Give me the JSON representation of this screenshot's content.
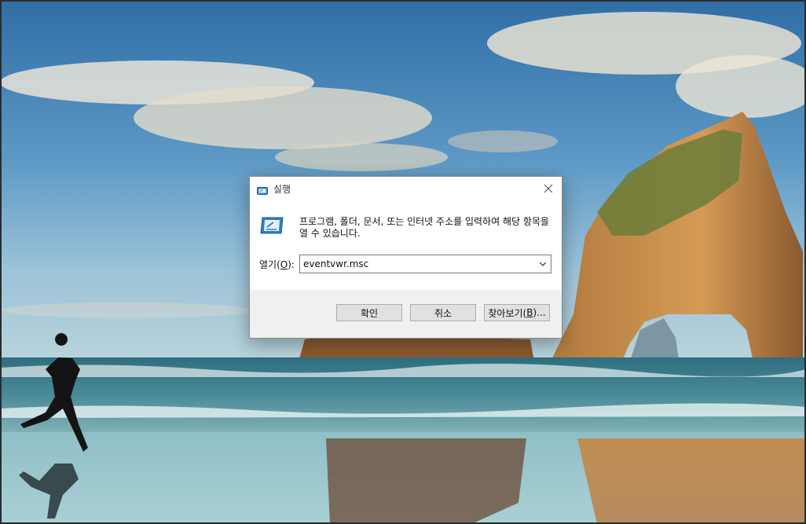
{
  "dialog": {
    "title": "실행",
    "description": "프로그램, 폴더, 문서, 또는 인터넷 주소를 입력하여 해당 항목을 열 수 있습니다.",
    "open_label": "열기(",
    "open_label_key": "O",
    "open_label_end": "):",
    "command_value": "eventvwr.msc",
    "ok_label": "확인",
    "cancel_label": "취소",
    "browse_label": "찾아보기(",
    "browse_key": "B",
    "browse_end": ")..."
  },
  "icons": {
    "title": "run-icon",
    "close": "close-icon",
    "dropdown": "chevron-down-icon"
  }
}
